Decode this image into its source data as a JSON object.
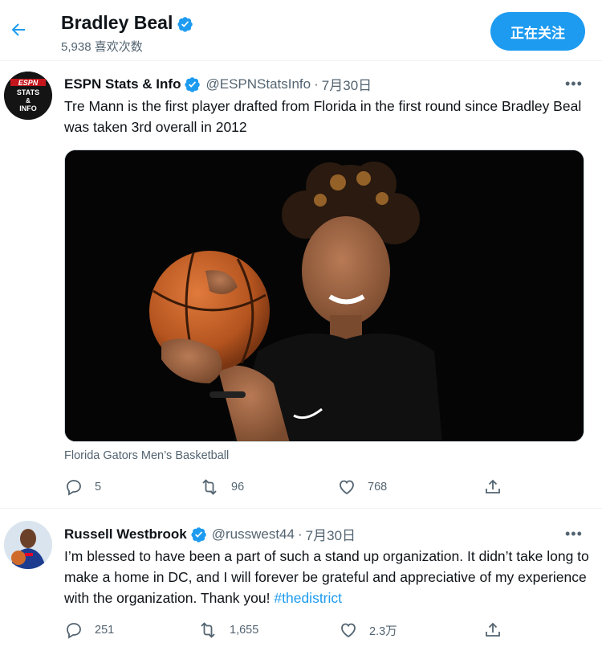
{
  "header": {
    "name": "Bradley Beal",
    "likes_count": "5,938 喜欢次数",
    "follow_label": "正在关注"
  },
  "tweets": [
    {
      "name": "ESPN Stats & Info",
      "handle": "@ESPNStatsInfo",
      "dot": "·",
      "date": "7月30日",
      "text": "Tre Mann is the first player drafted from Florida in the first round since Bradley Beal was taken 3rd overall in 2012",
      "avatar_lines": [
        "ESPN",
        "STATS",
        "&",
        "INFO"
      ],
      "media_caption": "Florida Gators Men’s Basketball",
      "replies": "5",
      "retweets": "96",
      "likes": "768"
    },
    {
      "name": "Russell Westbrook",
      "handle": "@russwest44",
      "dot": "·",
      "date": "7月30日",
      "text": "I’m blessed to have been a part of such a stand up organization. It didn’t take long to make a home in DC, and I will forever be grateful and appreciative of my experience with the organization. Thank you!",
      "hashtag": "#thedistrict",
      "replies": "251",
      "retweets": "1,655",
      "likes": "2.3万"
    }
  ],
  "colors": {
    "accent": "#1d9bf0",
    "secondary_text": "#536471",
    "divider": "#eff3f4"
  }
}
